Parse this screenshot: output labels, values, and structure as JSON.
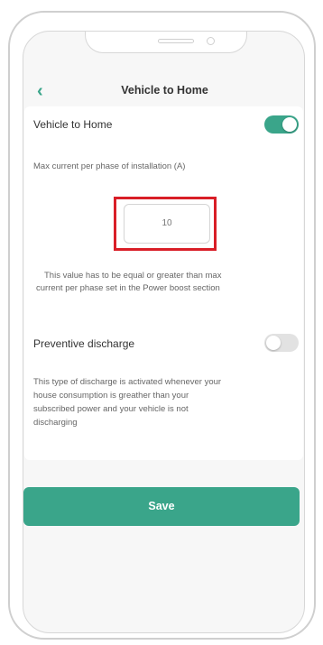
{
  "header": {
    "back_icon": "chevron-left-icon",
    "title": "Vehicle to Home"
  },
  "v2h": {
    "label": "Vehicle to Home",
    "enabled": true,
    "field_label": "Max current per phase of installation (A)",
    "value": "10",
    "hint_line1": "This value has to be equal or greater than max",
    "hint_line2": "current per phase set in the Power boost section"
  },
  "discharge": {
    "label": "Preventive discharge",
    "enabled": false,
    "desc_lines": [
      "This type of discharge is activated whenever your",
      "house consumption is greather than your",
      "subscribed power and your vehicle is not",
      "discharging"
    ]
  },
  "save_label": "Save",
  "colors": {
    "accent": "#3aa58a",
    "highlight": "#d91e27"
  }
}
